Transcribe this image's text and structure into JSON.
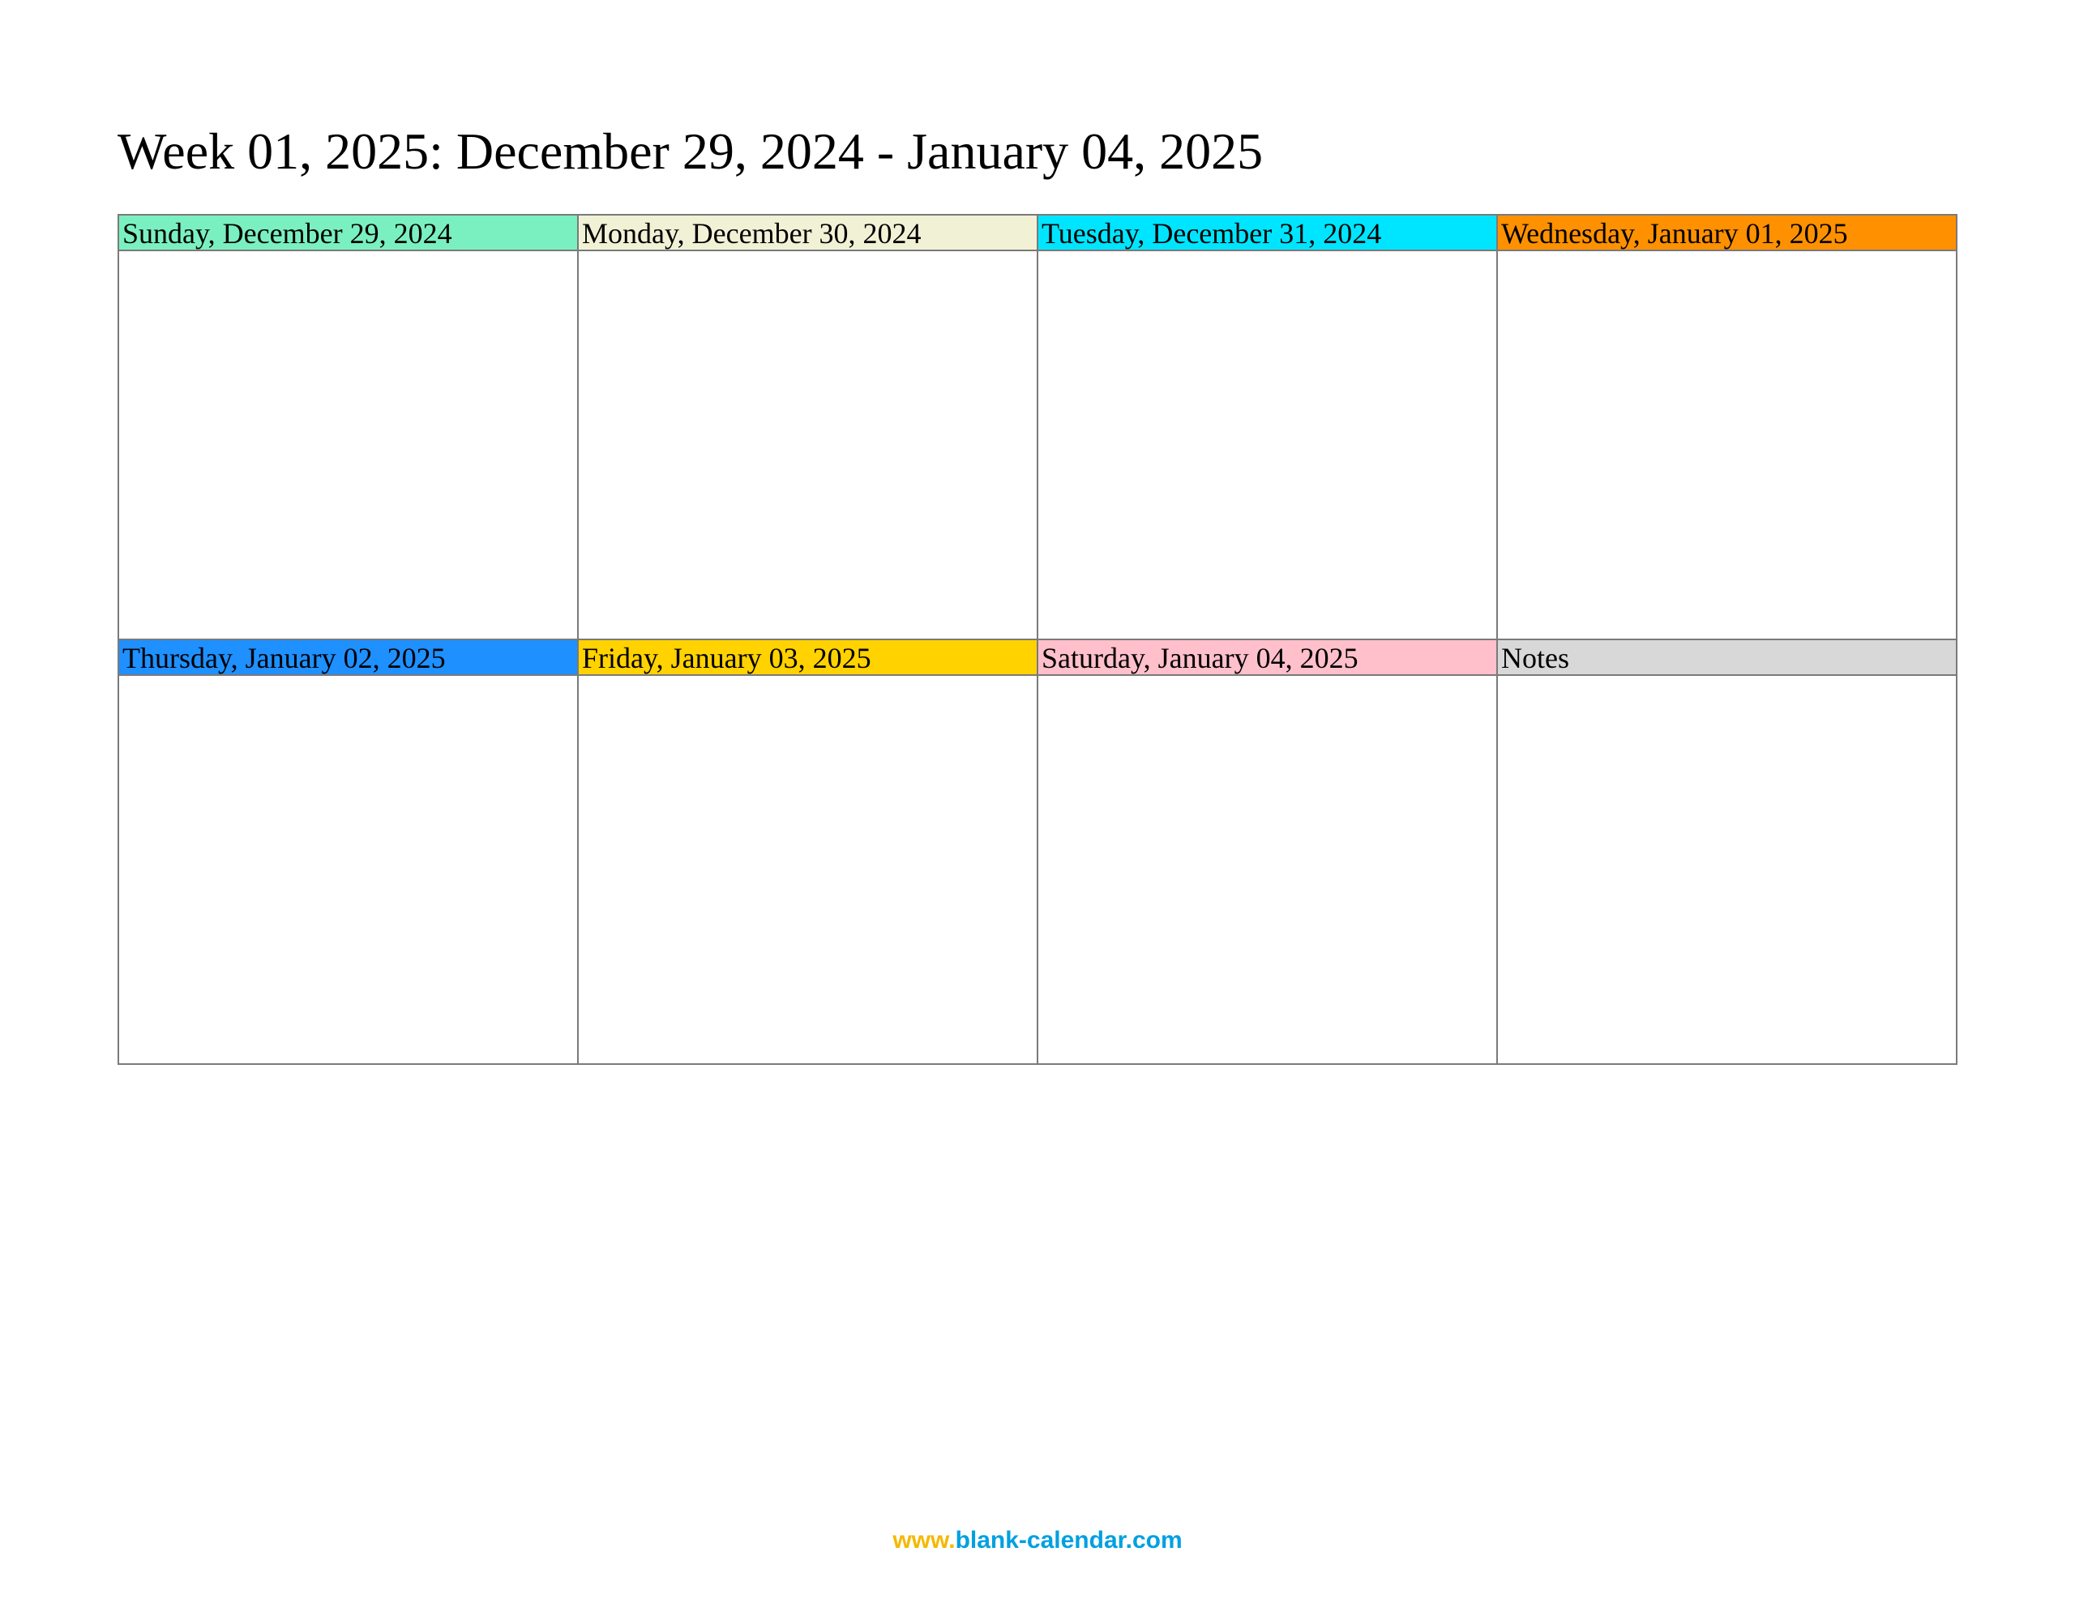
{
  "title": "Week 01, 2025: December 29, 2024 - January 04, 2025",
  "cells": {
    "sunday": "Sunday, December 29, 2024",
    "monday": "Monday, December 30, 2024",
    "tuesday": "Tuesday, December 31, 2024",
    "wednesday": "Wednesday, January 01, 2025",
    "thursday": "Thursday, January 02, 2025",
    "friday": "Friday, January 03, 2025",
    "saturday": "Saturday, January 04, 2025",
    "notes": "Notes"
  },
  "footer": {
    "part1": "www.",
    "part2": "blank-calendar.com"
  }
}
